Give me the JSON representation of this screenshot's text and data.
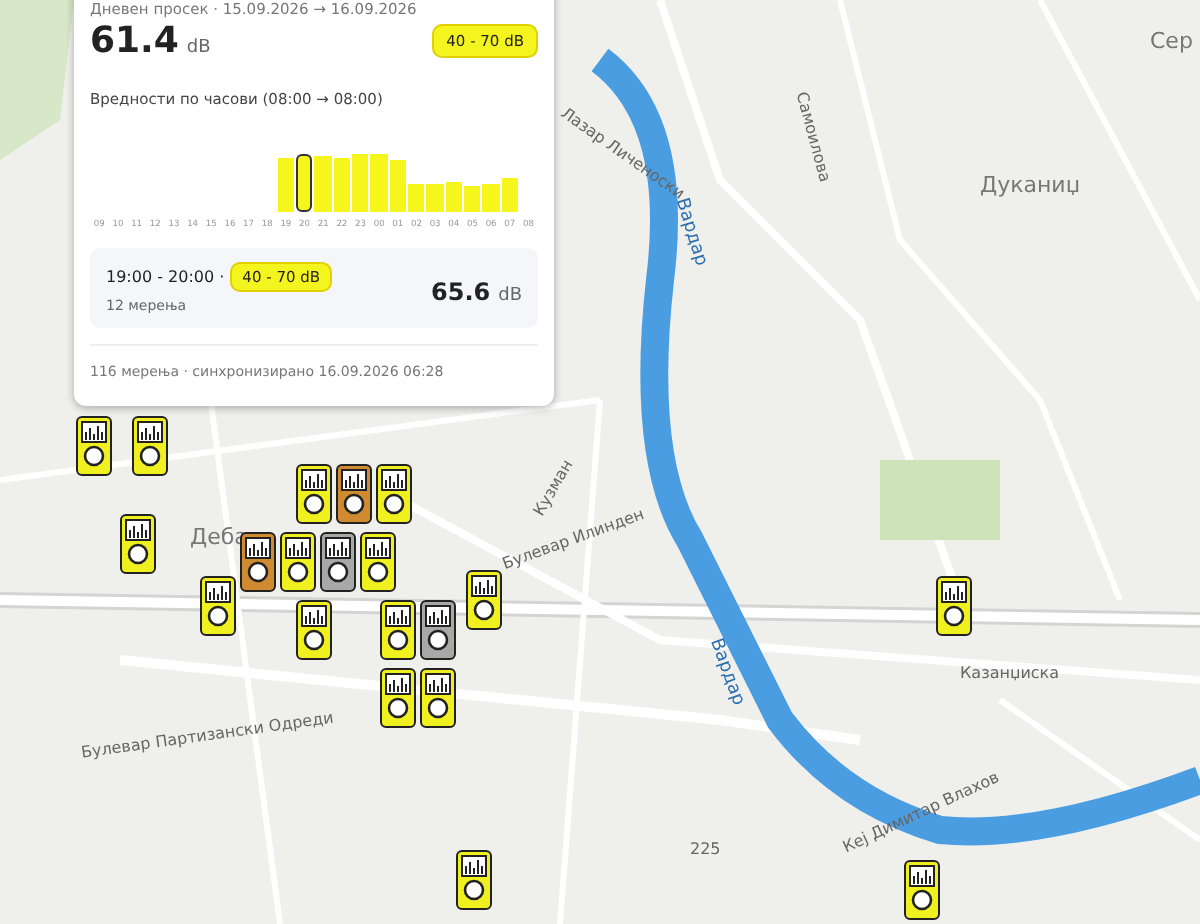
{
  "panel": {
    "period": "Дневен просек · 15.09.2026 → 16.09.2026",
    "average": "61.4",
    "unit": "dB",
    "range_badge": "40 - 70 dB",
    "hourly_title": "Вредности по часови (08:00 → 08:00)",
    "hours": [
      {
        "label": "09",
        "selected": false
      },
      {
        "label": "10",
        "selected": false
      },
      {
        "label": "11",
        "selected": false
      },
      {
        "label": "12",
        "selected": false
      },
      {
        "label": "13",
        "selected": false
      },
      {
        "label": "14",
        "selected": false
      },
      {
        "label": "15",
        "selected": false
      },
      {
        "label": "16",
        "selected": false
      },
      {
        "label": "17",
        "selected": false
      },
      {
        "label": "18",
        "selected": false
      },
      {
        "label": "19",
        "selected": false
      },
      {
        "label": "20",
        "selected": true
      },
      {
        "label": "21",
        "selected": false
      },
      {
        "label": "22",
        "selected": false
      },
      {
        "label": "23",
        "selected": false
      },
      {
        "label": "00",
        "selected": false
      },
      {
        "label": "01",
        "selected": false
      },
      {
        "label": "02",
        "selected": false
      },
      {
        "label": "03",
        "selected": false
      },
      {
        "label": "04",
        "selected": false
      },
      {
        "label": "05",
        "selected": false
      },
      {
        "label": "06",
        "selected": false
      },
      {
        "label": "07",
        "selected": false
      },
      {
        "label": "08",
        "selected": false
      }
    ],
    "detail": {
      "time": "19:00 - 20:00 ·",
      "badge": "40 - 70 dB",
      "count": "12 мерења",
      "value": "65.6",
      "unit": "dB"
    },
    "footer": "116 мерења · синхронизирано 16.09.2026 06:28"
  },
  "map_labels": [
    "Дуканиџ",
    "Сер",
    "Вардар",
    "Вардар",
    "Деба",
    "Булевар Партизански Одреди",
    "Булевар Илинден",
    "Самоилова",
    "Лазар Личеноски",
    "Кузман",
    "225",
    "Казанџиска",
    "Кеј Димитар Влахов"
  ],
  "markers": [
    {
      "color": "#f0f020"
    },
    {
      "color": "#f0f020"
    },
    {
      "color": "#f0f020"
    },
    {
      "color": "#d08a30"
    },
    {
      "color": "#f0f020"
    },
    {
      "color": "#f0f020"
    },
    {
      "color": "#f0f020"
    },
    {
      "color": "#d08a30"
    },
    {
      "color": "#f0f020"
    },
    {
      "color": "#a8a8a8"
    },
    {
      "color": "#f0f020"
    },
    {
      "color": "#f0f020"
    },
    {
      "color": "#f0f020"
    },
    {
      "color": "#f0f020"
    },
    {
      "color": "#a8a8a8"
    },
    {
      "color": "#f0f020"
    },
    {
      "color": "#f0f020"
    },
    {
      "color": "#f0f020"
    },
    {
      "color": "#f0f020"
    },
    {
      "color": "#f0f020"
    }
  ]
}
